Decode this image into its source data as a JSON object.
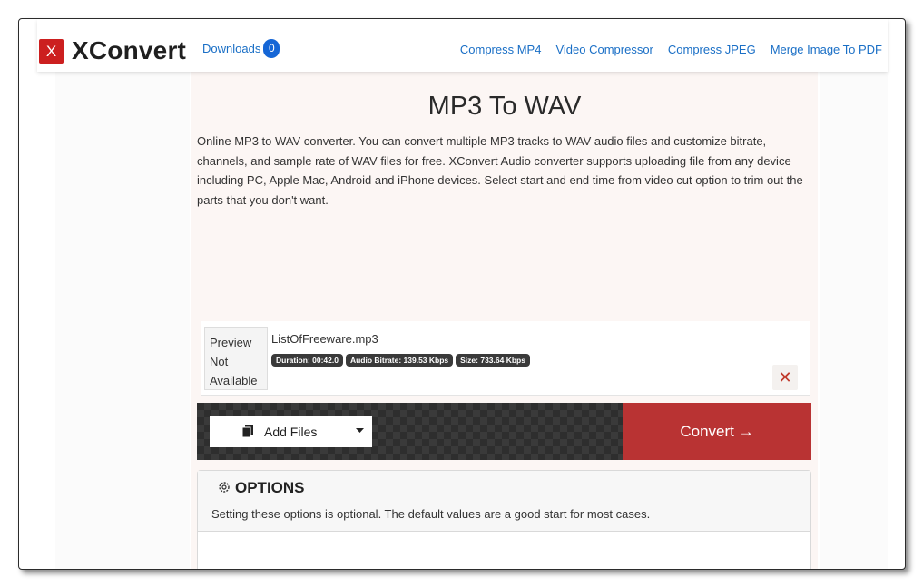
{
  "brand": {
    "logo_letter": "X",
    "name": "XConvert"
  },
  "nav": {
    "downloads_label": "Downloads",
    "downloads_count": "0",
    "links": [
      "Compress MP4",
      "Video Compressor",
      "Compress JPEG",
      "Merge Image To PDF"
    ]
  },
  "page": {
    "title": "MP3 To WAV",
    "description": "Online MP3 to WAV converter. You can convert multiple MP3 tracks to WAV audio files and customize bitrate, channels, and sample rate of WAV files for free. XConvert Audio converter supports uploading file from any device including PC, Apple Mac, Android and iPhone devices. Select start and end time from video cut option to trim out the parts that you don't want."
  },
  "file": {
    "preview_lines": [
      "Preview",
      "Not",
      "Available"
    ],
    "name": "ListOfFreeware.mp3",
    "duration": "Duration: 00:42.0",
    "bitrate": "Audio Bitrate: 139.53 Kbps",
    "size": "Size: 733.64 Kbps",
    "remove_glyph": "✕"
  },
  "actions": {
    "add_files": "Add Files",
    "convert": "Convert →"
  },
  "options": {
    "title": "OPTIONS",
    "note": "Setting these options is optional. The default values are a good start for most cases."
  },
  "colors": {
    "brand_red": "#cc1f1f",
    "convert_red": "#b93333",
    "link_blue": "#1a6fc6"
  }
}
